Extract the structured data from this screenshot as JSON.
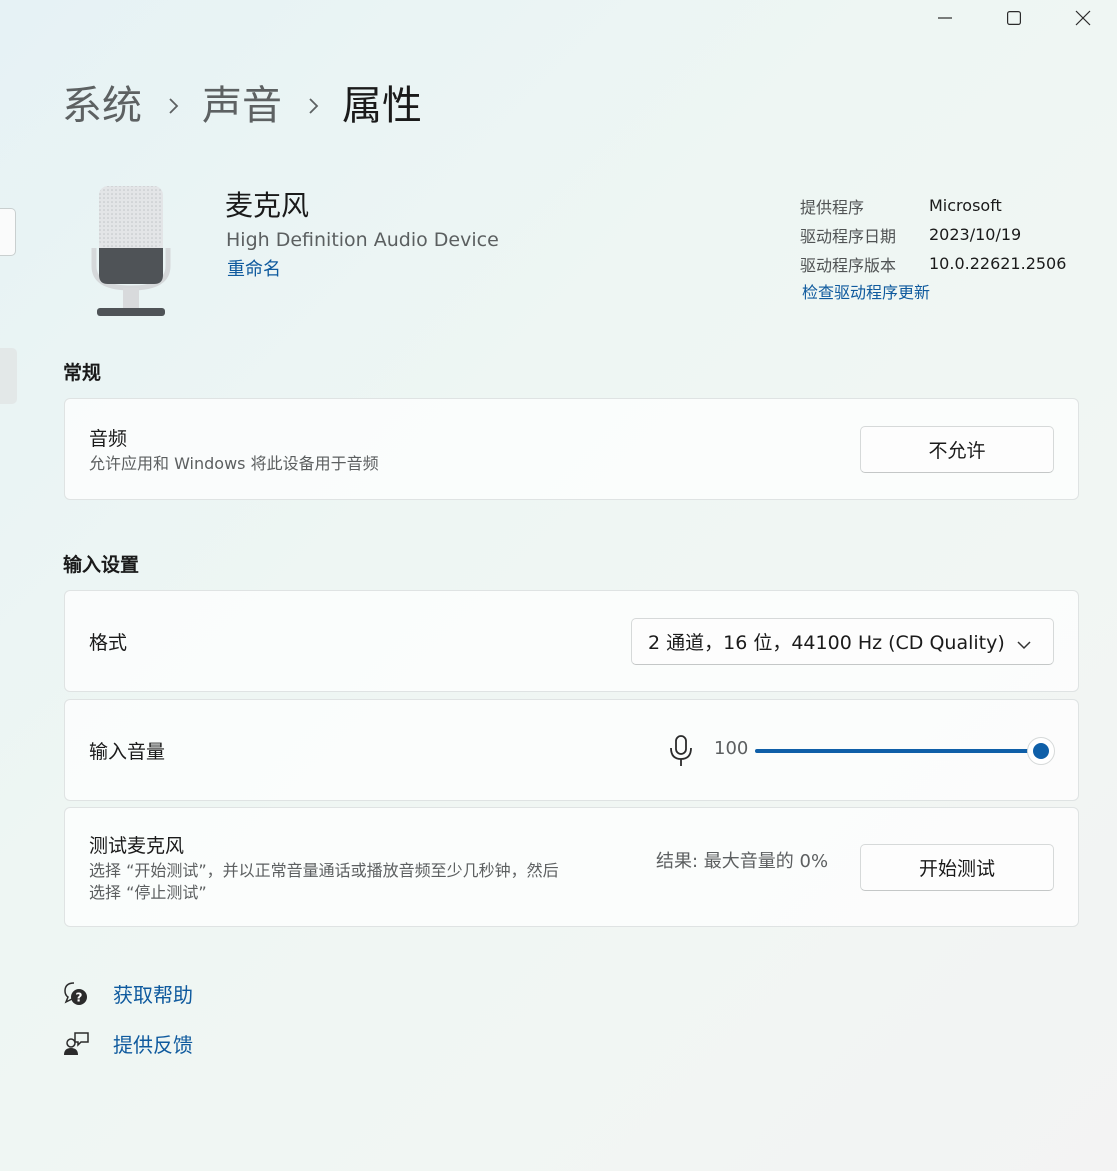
{
  "window": {
    "minimize_icon": "minimize-icon",
    "maximize_icon": "maximize-icon",
    "close_icon": "close-icon"
  },
  "breadcrumb": {
    "items": [
      "系统",
      "声音"
    ],
    "current": "属性"
  },
  "device": {
    "icon": "microphone-device-icon",
    "name": "麦克风",
    "description": "High Definition Audio Device",
    "rename_label": "重命名"
  },
  "driver": {
    "provider_label": "提供程序",
    "provider_value": "Microsoft",
    "date_label": "驱动程序日期",
    "date_value": "2023/10/19",
    "version_label": "驱动程序版本",
    "version_value": "10.0.22621.2506",
    "update_link": "检查驱动程序更新"
  },
  "general": {
    "section_title": "常规",
    "audio_title": "音频",
    "audio_desc": "允许应用和 Windows 将此设备用于音频",
    "audio_button": "不允许"
  },
  "input_settings": {
    "section_title": "输入设置",
    "format_label": "格式",
    "format_selected": "2 通道，16 位，44100 Hz (CD Quality)",
    "volume_label": "输入音量",
    "volume_icon": "microphone-icon",
    "volume_value": "100",
    "volume_level": 1.0,
    "accent_color": "#0f5fa8",
    "test_title": "测试麦克风",
    "test_desc_line1": "选择 “开始测试”，并以正常音量通话或播放音频至少几秒钟，然后",
    "test_desc_line2": "选择 “停止测试”",
    "test_result": "结果: 最大音量的 0%",
    "test_button": "开始测试"
  },
  "footer": {
    "help_label": "获取帮助",
    "help_icon": "help-chat-icon",
    "feedback_label": "提供反馈",
    "feedback_icon": "feedback-icon"
  }
}
